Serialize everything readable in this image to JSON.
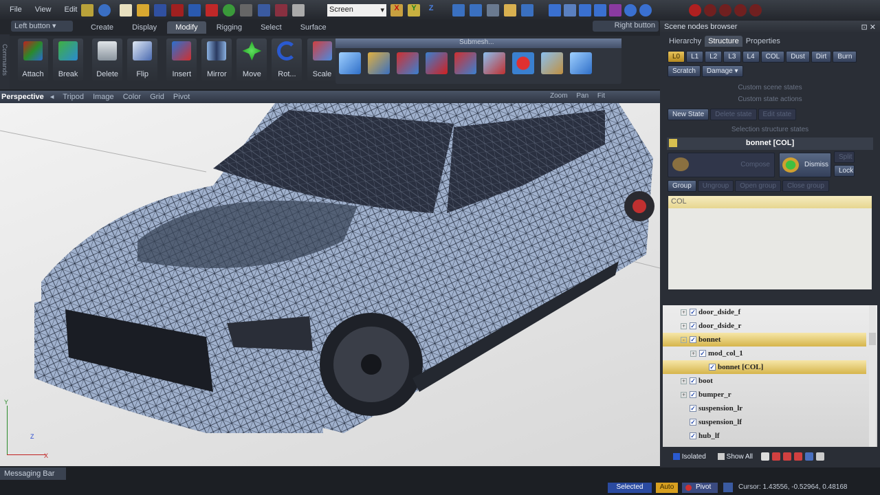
{
  "menu": {
    "items": [
      "File",
      "View",
      "Edit"
    ]
  },
  "toolbar": {
    "mode_select": "Screen"
  },
  "mouse": {
    "left": "Left button",
    "right": "Right button"
  },
  "tabs": [
    "Create",
    "Display",
    "Modify",
    "Rigging",
    "Select",
    "Surface"
  ],
  "active_tab": "Modify",
  "side_strip": "Commands",
  "tools": [
    "Attach",
    "Break",
    "Delete",
    "Flip",
    "Insert",
    "Mirror",
    "Move",
    "Rot...",
    "Scale"
  ],
  "submesh": {
    "title": "Submesh..."
  },
  "viewport": {
    "name": "Perspective",
    "options": [
      "Tripod",
      "Image",
      "Color",
      "Grid",
      "Pivot"
    ],
    "right": [
      "Zoom",
      "Pan",
      "Fit"
    ],
    "axes": {
      "y": "Y",
      "z": "Z",
      "x": "X"
    }
  },
  "panel": {
    "title": "Scene nodes browser",
    "tabs": [
      "Hierarchy",
      "Structure",
      "Properties"
    ],
    "active_tab": "Structure",
    "lod_buttons": [
      "L0",
      "L1",
      "L2",
      "L3",
      "L4",
      "COL",
      "Dust",
      "Dirt",
      "Burn"
    ],
    "scratch": "Scratch",
    "damage": "Damage",
    "custom_scene_states": "Custom scene states",
    "custom_state_actions": "Custom state actions",
    "new_state": "New State",
    "delete_state": "Delete state",
    "edit_state": "Edit state",
    "selection_states": "Selection structure states",
    "selected_node": "bonnet [COL]",
    "compose": "Compose",
    "dismiss": "Dismiss",
    "split": "Split",
    "lock": "Lock",
    "group": "Group",
    "ungroup": "Ungroup",
    "open_group": "Open group",
    "close_group": "Close group",
    "state_list": [
      "COL"
    ],
    "tree": [
      {
        "name": "door_dside_f",
        "level": 0,
        "exp": "+",
        "sel": false
      },
      {
        "name": "door_dside_r",
        "level": 0,
        "exp": "+",
        "sel": false
      },
      {
        "name": "bonnet",
        "level": 0,
        "exp": "-",
        "sel": true
      },
      {
        "name": "mod_col_1",
        "level": 1,
        "exp": "+",
        "sel": false
      },
      {
        "name": "bonnet [COL]",
        "level": 2,
        "exp": "",
        "sel": true
      },
      {
        "name": "boot",
        "level": 0,
        "exp": "+",
        "sel": false
      },
      {
        "name": "bumper_r",
        "level": 0,
        "exp": "+",
        "sel": false
      },
      {
        "name": "suspension_lr",
        "level": 0,
        "exp": "",
        "sel": false
      },
      {
        "name": "suspension_lf",
        "level": 0,
        "exp": "",
        "sel": false
      },
      {
        "name": "hub_lf",
        "level": 0,
        "exp": "",
        "sel": false
      }
    ],
    "isolated": "Isolated",
    "show_all": "Show All"
  },
  "messaging_bar": "Messaging Bar",
  "status": {
    "selected": "Selected",
    "auto": "Auto",
    "pivot": "Pivot",
    "cursor": "Cursor: 1.43556, -0.52964, 0.48168"
  }
}
